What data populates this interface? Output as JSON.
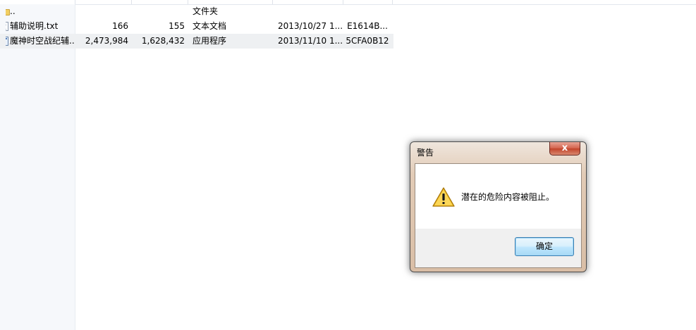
{
  "files": [
    {
      "name": "..",
      "size": "",
      "packed": "",
      "type": "文件夹",
      "modified": "",
      "crc": "",
      "icon": "folder-icon",
      "selected": false
    },
    {
      "name": "辅助说明.txt",
      "size": "166",
      "packed": "155",
      "type": "文本文档",
      "modified": "2013/10/27 1...",
      "crc": "E1614B...",
      "icon": "text-file-icon",
      "selected": false
    },
    {
      "name": "魔神时空战纪辅...",
      "size": "2,473,984",
      "packed": "1,628,432",
      "type": "应用程序",
      "modified": "2013/11/10 1...",
      "crc": "5CFA0B12",
      "icon": "executable-icon",
      "selected": true
    }
  ],
  "dialog": {
    "title": "警告",
    "close_label": "x",
    "message": "潜在的危险内容被阻止。",
    "ok_label": "确定",
    "icon": "warning-icon"
  },
  "colors": {
    "warning_yellow": "#f7c52a",
    "button_border": "#3c7fb1",
    "close_red": "#c24329"
  }
}
